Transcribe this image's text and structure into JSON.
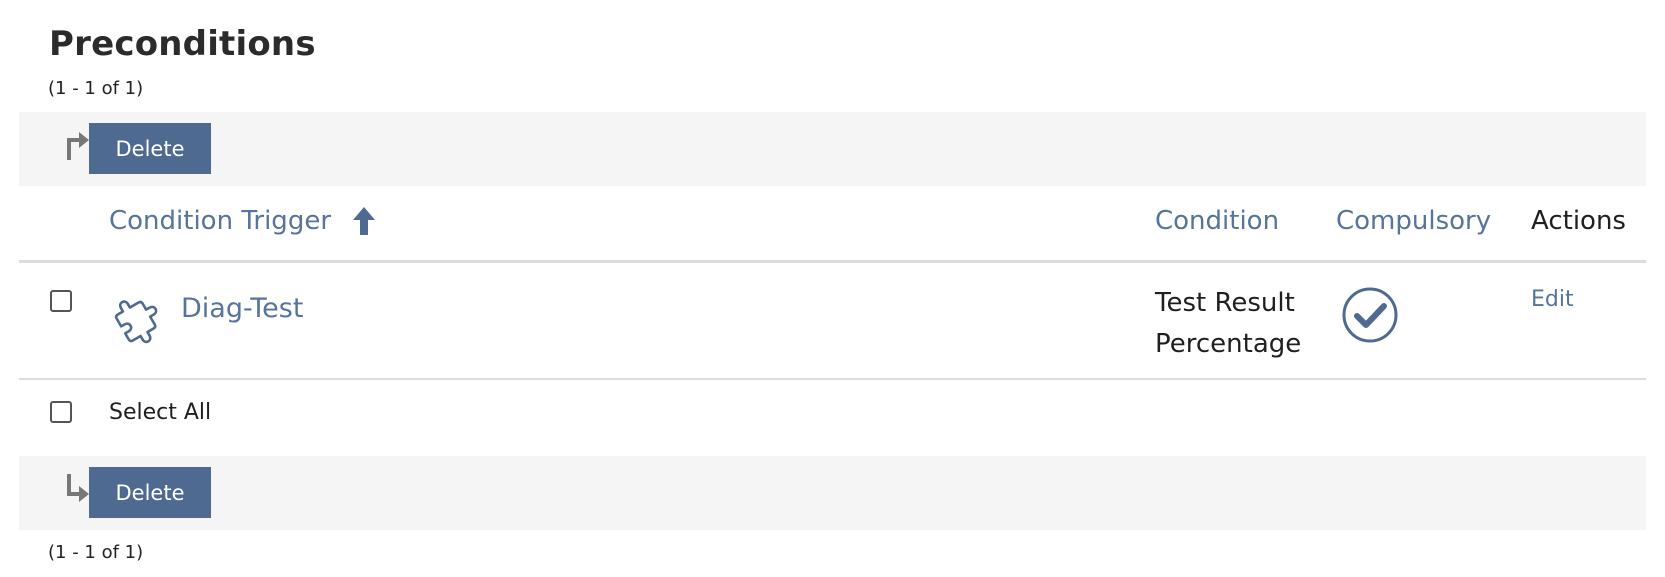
{
  "section": {
    "title": "Preconditions",
    "count_top": "(1 - 1 of 1)",
    "count_bottom": "(1 - 1 of 1)"
  },
  "toolbar": {
    "delete_label": "Delete"
  },
  "table": {
    "columns": {
      "trigger": "Condition Trigger",
      "condition": "Condition",
      "compulsory": "Compulsory",
      "actions": "Actions"
    },
    "rows": [
      {
        "trigger": "Diag-Test",
        "condition_line1": "Test Result",
        "condition_line2": "Percentage",
        "compulsory": true,
        "action": "Edit"
      }
    ],
    "select_all_label": "Select All"
  },
  "colors": {
    "accent": "#56749c",
    "button_bg": "#4e6a91",
    "toolbar_bg": "#f5f5f6"
  }
}
